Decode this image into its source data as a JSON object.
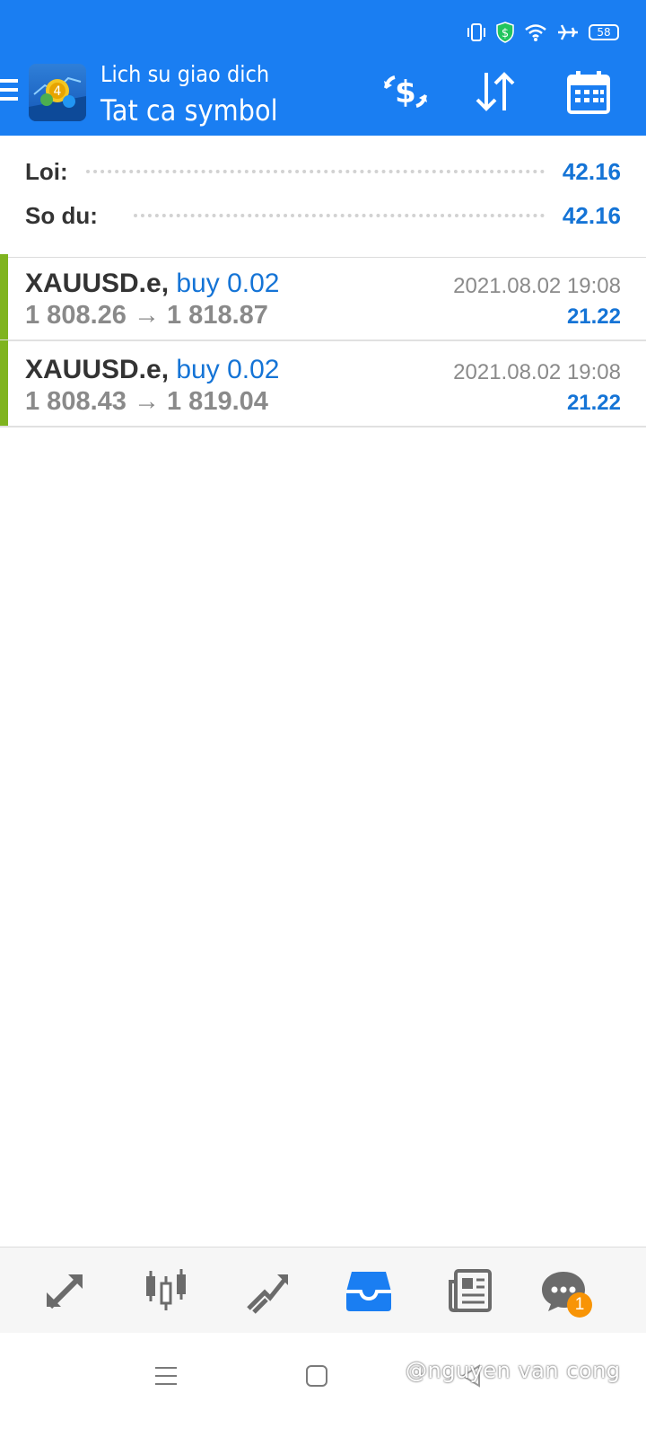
{
  "status_bar": {
    "battery": "58",
    "icons": [
      "vibrate-icon",
      "shield-dollar-icon",
      "wifi-icon",
      "airplane-icon",
      "battery-icon"
    ]
  },
  "header": {
    "subtitle": "Lich su giao dich",
    "title": "Tat ca symbol",
    "actions": [
      "currency-exchange-icon",
      "sort-icon",
      "calendar-icon"
    ]
  },
  "summary": {
    "profit_label": "Loi:",
    "profit_value": "42.16",
    "balance_label": "So du:",
    "balance_value": "42.16"
  },
  "deals": [
    {
      "symbol": "XAUUSD.e",
      "side": "buy 0.02",
      "prices": "1 808.26 → 1 818.87",
      "time": "2021.08.02 19:08",
      "profit": "21.22"
    },
    {
      "symbol": "XAUUSD.e",
      "side": "buy 0.02",
      "prices": "1 808.43 → 1 819.04",
      "time": "2021.08.02 19:08",
      "profit": "21.22"
    }
  ],
  "bottom_nav": {
    "items": [
      "quotes-icon",
      "chart-candles-icon",
      "trade-icon",
      "history-icon",
      "news-icon",
      "chat-icon"
    ],
    "active": "history-icon",
    "chat_badge": "1"
  },
  "system_nav": {
    "watermark": "@nguyen van cong"
  },
  "colors": {
    "appbar": "#1a7ef2",
    "accent": "#1574d6",
    "buy_bar": "#7fb41f",
    "badge": "#f89406"
  }
}
